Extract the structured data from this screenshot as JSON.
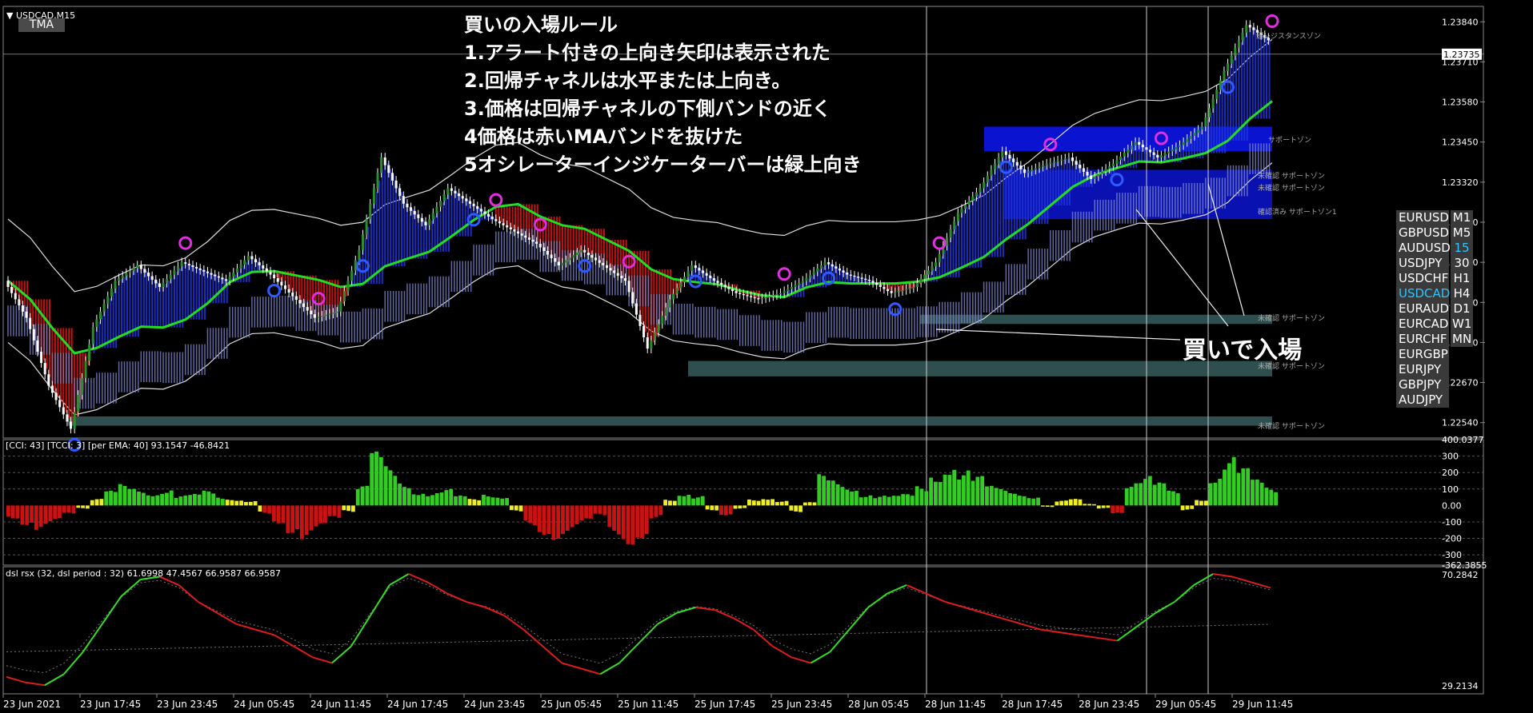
{
  "symbol_title": "USDCAD,M15",
  "indicator_tag": "TMA",
  "rules": [
    "買いの入場ルール",
    "1.アラート付きの上向き矢印は表示された",
    "2.回帰チャネルは水平または上向き。",
    "3.価格は回帰チャネルの下側バンドの近く",
    "4価格は赤いMAバンドを抜けた",
    "5オシレーターインジケーターバーは緑上向き"
  ],
  "entry_label": "買いで入場",
  "zone_labels": {
    "resistance": "頭レジスタンスゾン",
    "support": "サポートゾン",
    "unconfirmed_support_a": "未確認 サポートゾン",
    "unconfirmed_support_b": "未確認 サポートゾン",
    "confirmed_support": "確認済み サポートゾン1",
    "unconfirmed_low_1": "未確認 サポートゾン",
    "unconfirmed_low_2": "未確認 サポートゾン",
    "unconfirmed_low_3": "未確認 サポートゾン"
  },
  "price_axis": [
    "1.23840",
    "1.23710",
    "1.23580",
    "1.23450",
    "1.23320",
    "1.23190",
    "1.23060",
    "1.22930",
    "1.22800",
    "1.22670",
    "1.22540"
  ],
  "current_price": "1.23735",
  "cci_label": "[CCI: 43] [TCCI: 3] [per EMA: 40]  93.1547 -46.8421",
  "cci_axis": [
    "400.0377",
    "300",
    "200",
    "100",
    "0.00",
    "-100",
    "-200",
    "-300",
    "-362.3855"
  ],
  "rsx_label": "dsl rsx (32, dsl period : 32) 61.6998 47.4567 66.9587 66.9587",
  "rsx_axis": [
    "70.2842",
    "29.2134"
  ],
  "time_axis": [
    "23 Jun 2021",
    "23 Jun 17:45",
    "23 Jun 23:45",
    "24 Jun 05:45",
    "24 Jun 11:45",
    "24 Jun 17:45",
    "24 Jun 23:45",
    "25 Jun 05:45",
    "25 Jun 11:45",
    "25 Jun 17:45",
    "25 Jun 23:45",
    "28 Jun 05:45",
    "28 Jun 11:45",
    "28 Jun 17:45",
    "28 Jun 23:45",
    "29 Jun 05:45",
    "29 Jun 11:45"
  ],
  "symbols": [
    {
      "sym": "EURUSD",
      "tf": "M1"
    },
    {
      "sym": "GBPUSD",
      "tf": "M5"
    },
    {
      "sym": "AUDUSD",
      "tf": "15"
    },
    {
      "sym": "USDJPY",
      "tf": "30"
    },
    {
      "sym": "USDCHF",
      "tf": "H1"
    },
    {
      "sym": "USDCAD",
      "tf": "H4"
    },
    {
      "sym": "EURAUD",
      "tf": "D1"
    },
    {
      "sym": "EURCAD",
      "tf": "W1"
    },
    {
      "sym": "EURCHF",
      "tf": "MN"
    },
    {
      "sym": "EURGBP",
      "tf": ""
    },
    {
      "sym": "EURJPY",
      "tf": ""
    },
    {
      "sym": "GBPJPY",
      "tf": ""
    },
    {
      "sym": "AUDJPY",
      "tf": ""
    }
  ],
  "active_symbol": "USDCAD",
  "active_tf": "15",
  "colors": {
    "bull_candle": "#2a8f2a",
    "bear_candle": "#ffffff",
    "tma_up_band": "#1f33d6",
    "tma_down_band": "#d41414",
    "ma_green": "#22dd22",
    "ma_red": "#ee1c1c",
    "channel": "#dddddd",
    "support_zone": "#2f4f4f",
    "resistance_zone": "#0a14d0",
    "cci_up": "#33cc22",
    "cci_down": "#cc1111",
    "cci_neutral": "#eeee22",
    "rsx_up": "#33dd22",
    "rsx_down": "#dd1c1c"
  },
  "chart_data": [
    {
      "type": "candlestick",
      "title": "USDCAD,M15",
      "ylim": [
        1.2249,
        1.2389
      ],
      "x_ticks": [
        "23 Jun 2021",
        "23 Jun 17:45",
        "23 Jun 23:45",
        "24 Jun 05:45",
        "24 Jun 11:45",
        "24 Jun 17:45",
        "24 Jun 23:45",
        "25 Jun 05:45",
        "25 Jun 11:45",
        "25 Jun 17:45",
        "25 Jun 23:45",
        "28 Jun 05:45",
        "28 Jun 11:45",
        "28 Jun 17:45",
        "28 Jun 23:45",
        "29 Jun 05:45",
        "29 Jun 11:45"
      ],
      "close_path": [
        1.23,
        1.2288,
        1.2266,
        1.2252,
        1.2285,
        1.23,
        1.2305,
        1.2298,
        1.2306,
        1.2303,
        1.23,
        1.2308,
        1.2302,
        1.2295,
        1.2288,
        1.229,
        1.231,
        1.234,
        1.2325,
        1.2318,
        1.233,
        1.2325,
        1.232,
        1.2316,
        1.2312,
        1.2305,
        1.231,
        1.2305,
        1.23,
        1.2278,
        1.2294,
        1.2305,
        1.23,
        1.2296,
        1.2294,
        1.2296,
        1.23,
        1.2306,
        1.2302,
        1.23,
        1.2296,
        1.2298,
        1.2306,
        1.2322,
        1.233,
        1.2342,
        1.2335,
        1.2338,
        1.234,
        1.2333,
        1.2338,
        1.2345,
        1.234,
        1.2344,
        1.235,
        1.2368,
        1.2383,
        1.2378
      ],
      "support_zones": [
        [
          1.2286,
          1.2289
        ],
        [
          1.2269,
          1.2274
        ],
        [
          1.2253,
          1.2256
        ]
      ],
      "resistance_zones": [
        [
          1.2342,
          1.235
        ],
        [
          1.232,
          1.2336
        ]
      ],
      "current_price": 1.23735
    },
    {
      "type": "bar",
      "title": "[CCI: 43] [TCCI: 3] [per EMA: 40]  93.1547 -46.8421",
      "ylim": [
        -362.3855,
        400.0377
      ],
      "values": [
        -80,
        -120,
        -150,
        -110,
        -60,
        -20,
        40,
        90,
        130,
        110,
        80,
        100,
        60,
        70,
        90,
        50,
        40,
        30,
        -50,
        -110,
        -170,
        -210,
        -150,
        -90,
        -40,
        120,
        330,
        240,
        150,
        90,
        80,
        100,
        60,
        40,
        70,
        60,
        -40,
        -120,
        -180,
        -210,
        -160,
        -110,
        -70,
        -180,
        -240,
        -200,
        -80,
        40,
        80,
        60,
        -30,
        -60,
        -20,
        40,
        50,
        30,
        -40,
        20,
        190,
        160,
        120,
        70,
        60,
        60,
        70,
        120,
        200,
        260,
        220,
        180,
        120,
        100,
        80,
        60,
        -10,
        30,
        40,
        10,
        -20,
        -60,
        150,
        180,
        140,
        90,
        -30,
        40,
        190,
        300,
        230,
        160,
        110
      ]
    },
    {
      "type": "line",
      "title": "dsl rsx (32, dsl period : 32) 61.6998 47.4567 66.9587 66.9587",
      "ylim": [
        29.2134,
        70.2842
      ],
      "values": [
        33,
        31,
        30,
        34,
        42,
        52,
        62,
        68,
        69,
        66,
        60,
        56,
        52,
        50,
        48,
        44,
        40,
        38,
        44,
        55,
        66,
        70,
        67,
        63,
        60,
        58,
        55,
        50,
        44,
        38,
        36,
        34,
        38,
        45,
        52,
        56,
        58,
        57,
        54,
        50,
        44,
        40,
        38,
        42,
        50,
        58,
        63,
        66,
        63,
        60,
        58,
        56,
        54,
        52,
        50,
        49,
        48,
        47,
        46,
        51,
        56,
        60,
        66,
        70,
        69,
        67,
        65
      ]
    }
  ]
}
